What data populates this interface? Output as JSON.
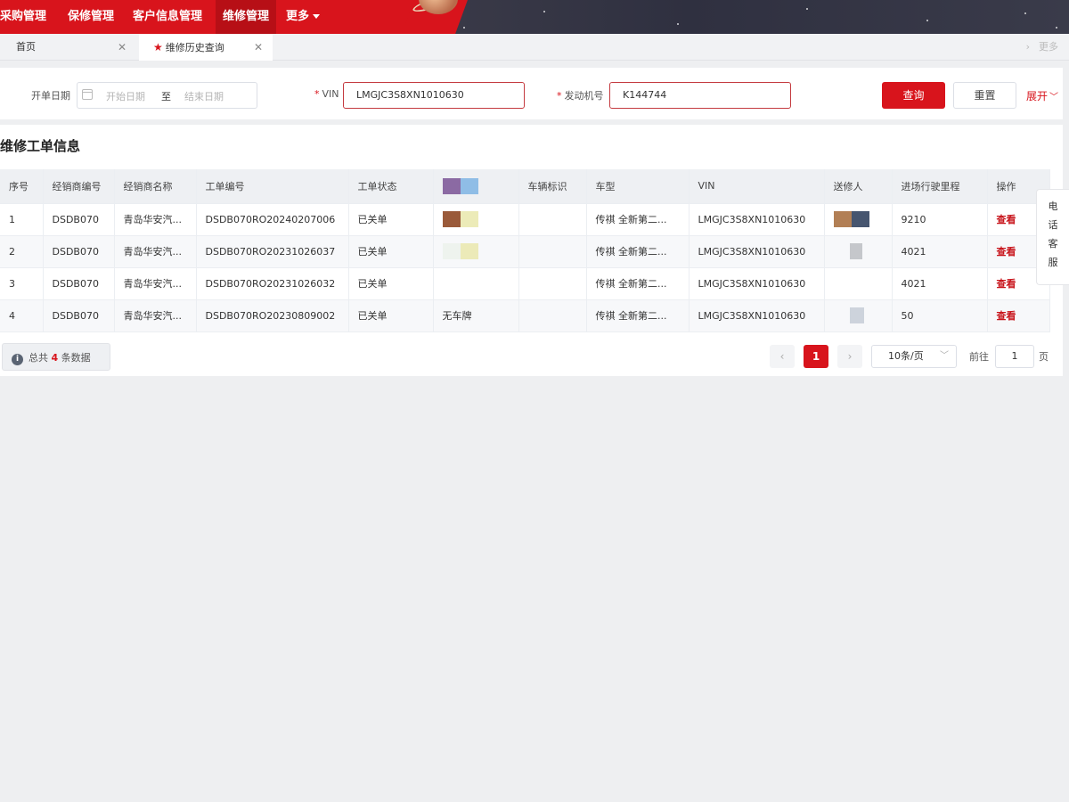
{
  "nav": {
    "items": [
      {
        "label": "采购管理",
        "active": false
      },
      {
        "label": "保修管理",
        "active": false
      },
      {
        "label": "客户信息管理",
        "active": false
      },
      {
        "label": "维修管理",
        "active": true
      },
      {
        "label": "更多",
        "active": false
      }
    ]
  },
  "tabs": [
    {
      "label": "首页",
      "active": false
    },
    {
      "label": "维修历史查询",
      "active": true
    }
  ],
  "tabbar_more": "更多",
  "search": {
    "date_label": "开单日期",
    "start_placeholder": "开始日期",
    "date_separator": "至",
    "end_placeholder": "结束日期",
    "vin_label": "VIN",
    "vin_value": "LMGJC3S8XN1010630",
    "engine_label": "发动机号",
    "engine_value": "K144744",
    "query_button": "查询",
    "reset_button": "重置",
    "expand_label": "展开"
  },
  "section_title": "维修工单信息",
  "table": {
    "columns": [
      "序号",
      "经销商编号",
      "经销商名称",
      "工单编号",
      "工单状态",
      "",
      "车辆标识",
      "车型",
      "VIN",
      "送修人",
      "进场行驶里程",
      "操作"
    ],
    "rows": [
      {
        "no": "1",
        "dealer_code": "DSDB070",
        "dealer_name": "青岛华安汽...",
        "order_no": "DSDB070RO20240207006",
        "status": "已关单",
        "plate": "",
        "vehicle_id": "",
        "model": "传祺 全新第二...",
        "vin": "LMGJC3S8XN1010630",
        "sender": "",
        "mileage": "9210",
        "action": "查看"
      },
      {
        "no": "2",
        "dealer_code": "DSDB070",
        "dealer_name": "青岛华安汽...",
        "order_no": "DSDB070RO20231026037",
        "status": "已关单",
        "plate": "",
        "vehicle_id": "",
        "model": "传祺 全新第二...",
        "vin": "LMGJC3S8XN1010630",
        "sender": "",
        "mileage": "4021",
        "action": "查看"
      },
      {
        "no": "3",
        "dealer_code": "DSDB070",
        "dealer_name": "青岛华安汽...",
        "order_no": "DSDB070RO20231026032",
        "status": "已关单",
        "plate": "",
        "vehicle_id": "",
        "model": "传祺 全新第二...",
        "vin": "LMGJC3S8XN1010630",
        "sender": "",
        "mileage": "4021",
        "action": "查看"
      },
      {
        "no": "4",
        "dealer_code": "DSDB070",
        "dealer_name": "青岛华安汽...",
        "order_no": "DSDB070RO20230809002",
        "status": "已关单",
        "plate": "无车牌",
        "vehicle_id": "",
        "model": "传祺 全新第二...",
        "vin": "LMGJC3S8XN1010630",
        "sender": "",
        "mileage": "50",
        "action": "查看"
      }
    ]
  },
  "footer": {
    "total_prefix": "总共",
    "total_count": "4",
    "total_suffix": "条数据",
    "current_page": "1",
    "page_size": "10条/页",
    "goto_prefix": "前往",
    "goto_value": "1",
    "goto_suffix": "页"
  },
  "side_service": [
    "电",
    "话",
    "客",
    "服"
  ],
  "colors": {
    "brand": "#d8141c",
    "nav_dark": "#2f3040"
  }
}
